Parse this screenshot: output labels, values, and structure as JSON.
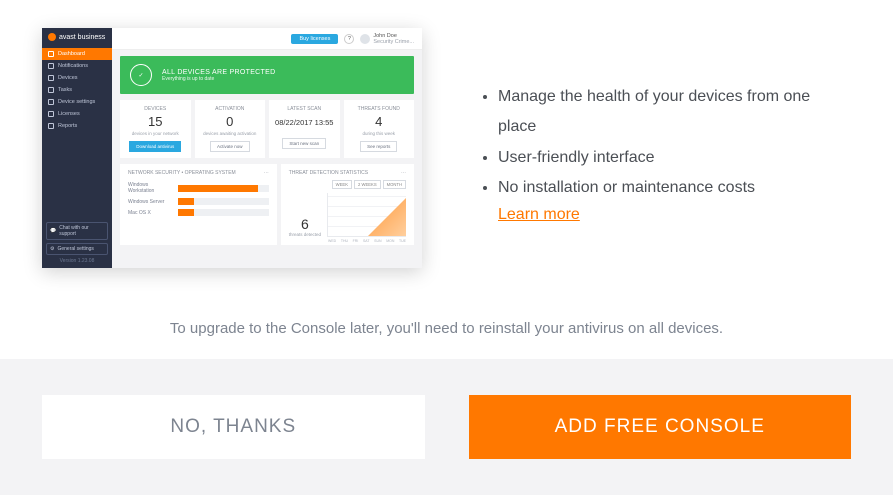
{
  "screenshot": {
    "brand": "avast business",
    "nav": [
      "Dashboard",
      "Notifications",
      "Devices",
      "Tasks",
      "Device settings",
      "Licenses",
      "Reports"
    ],
    "footer_buttons": [
      "Chat with our support",
      "General settings"
    ],
    "version": "Version 1.23.08",
    "topbar": {
      "buy": "Buy licenses",
      "help": "?",
      "user_name": "John Doe",
      "user_sub": "Security Crime..."
    },
    "greenbar": {
      "title": "ALL DEVICES ARE PROTECTED",
      "sub": "Everything is up to date"
    },
    "stats": [
      {
        "label": "DEVICES",
        "value": "15",
        "sub": "devices in your network",
        "btn": "Download antivirus",
        "blue": true
      },
      {
        "label": "ACTIVATION",
        "value": "0",
        "sub": "devices awaiting activation",
        "btn": "Activate now",
        "blue": false
      },
      {
        "label": "LATEST SCAN",
        "value": "08/22/2017 13:55",
        "sub": "",
        "btn": "Start new scan",
        "blue": false
      },
      {
        "label": "THREATS FOUND",
        "value": "4",
        "sub": "during this week",
        "btn": "See reports",
        "blue": false
      }
    ],
    "os_panel": {
      "title": "NETWORK SECURITY • OPERATING SYSTEM",
      "rows": [
        {
          "name": "Windows Workstation",
          "pct": 88,
          "val": "11"
        },
        {
          "name": "Windows Server",
          "pct": 18,
          "val": "2"
        },
        {
          "name": "Mac OS X",
          "pct": 18,
          "val": "2"
        }
      ]
    },
    "threat_panel": {
      "title": "THREAT DETECTION STATISTICS",
      "tabs": [
        "WEEK",
        "2 WEEKS",
        "MONTH"
      ],
      "big": "6",
      "big_label": "threats detected",
      "xlabels": [
        "WED",
        "THU",
        "FRI",
        "SAT",
        "SUN",
        "MON",
        "TUE"
      ]
    }
  },
  "bullets": [
    "Manage the health of your devices from one place",
    "User-friendly interface",
    "No installation or maintenance costs"
  ],
  "learn_more": "Learn more",
  "note": "To upgrade to the Console later, you'll need to reinstall your antivirus on all devices.",
  "buttons": {
    "no": "NO, THANKS",
    "add": "ADD FREE CONSOLE"
  }
}
